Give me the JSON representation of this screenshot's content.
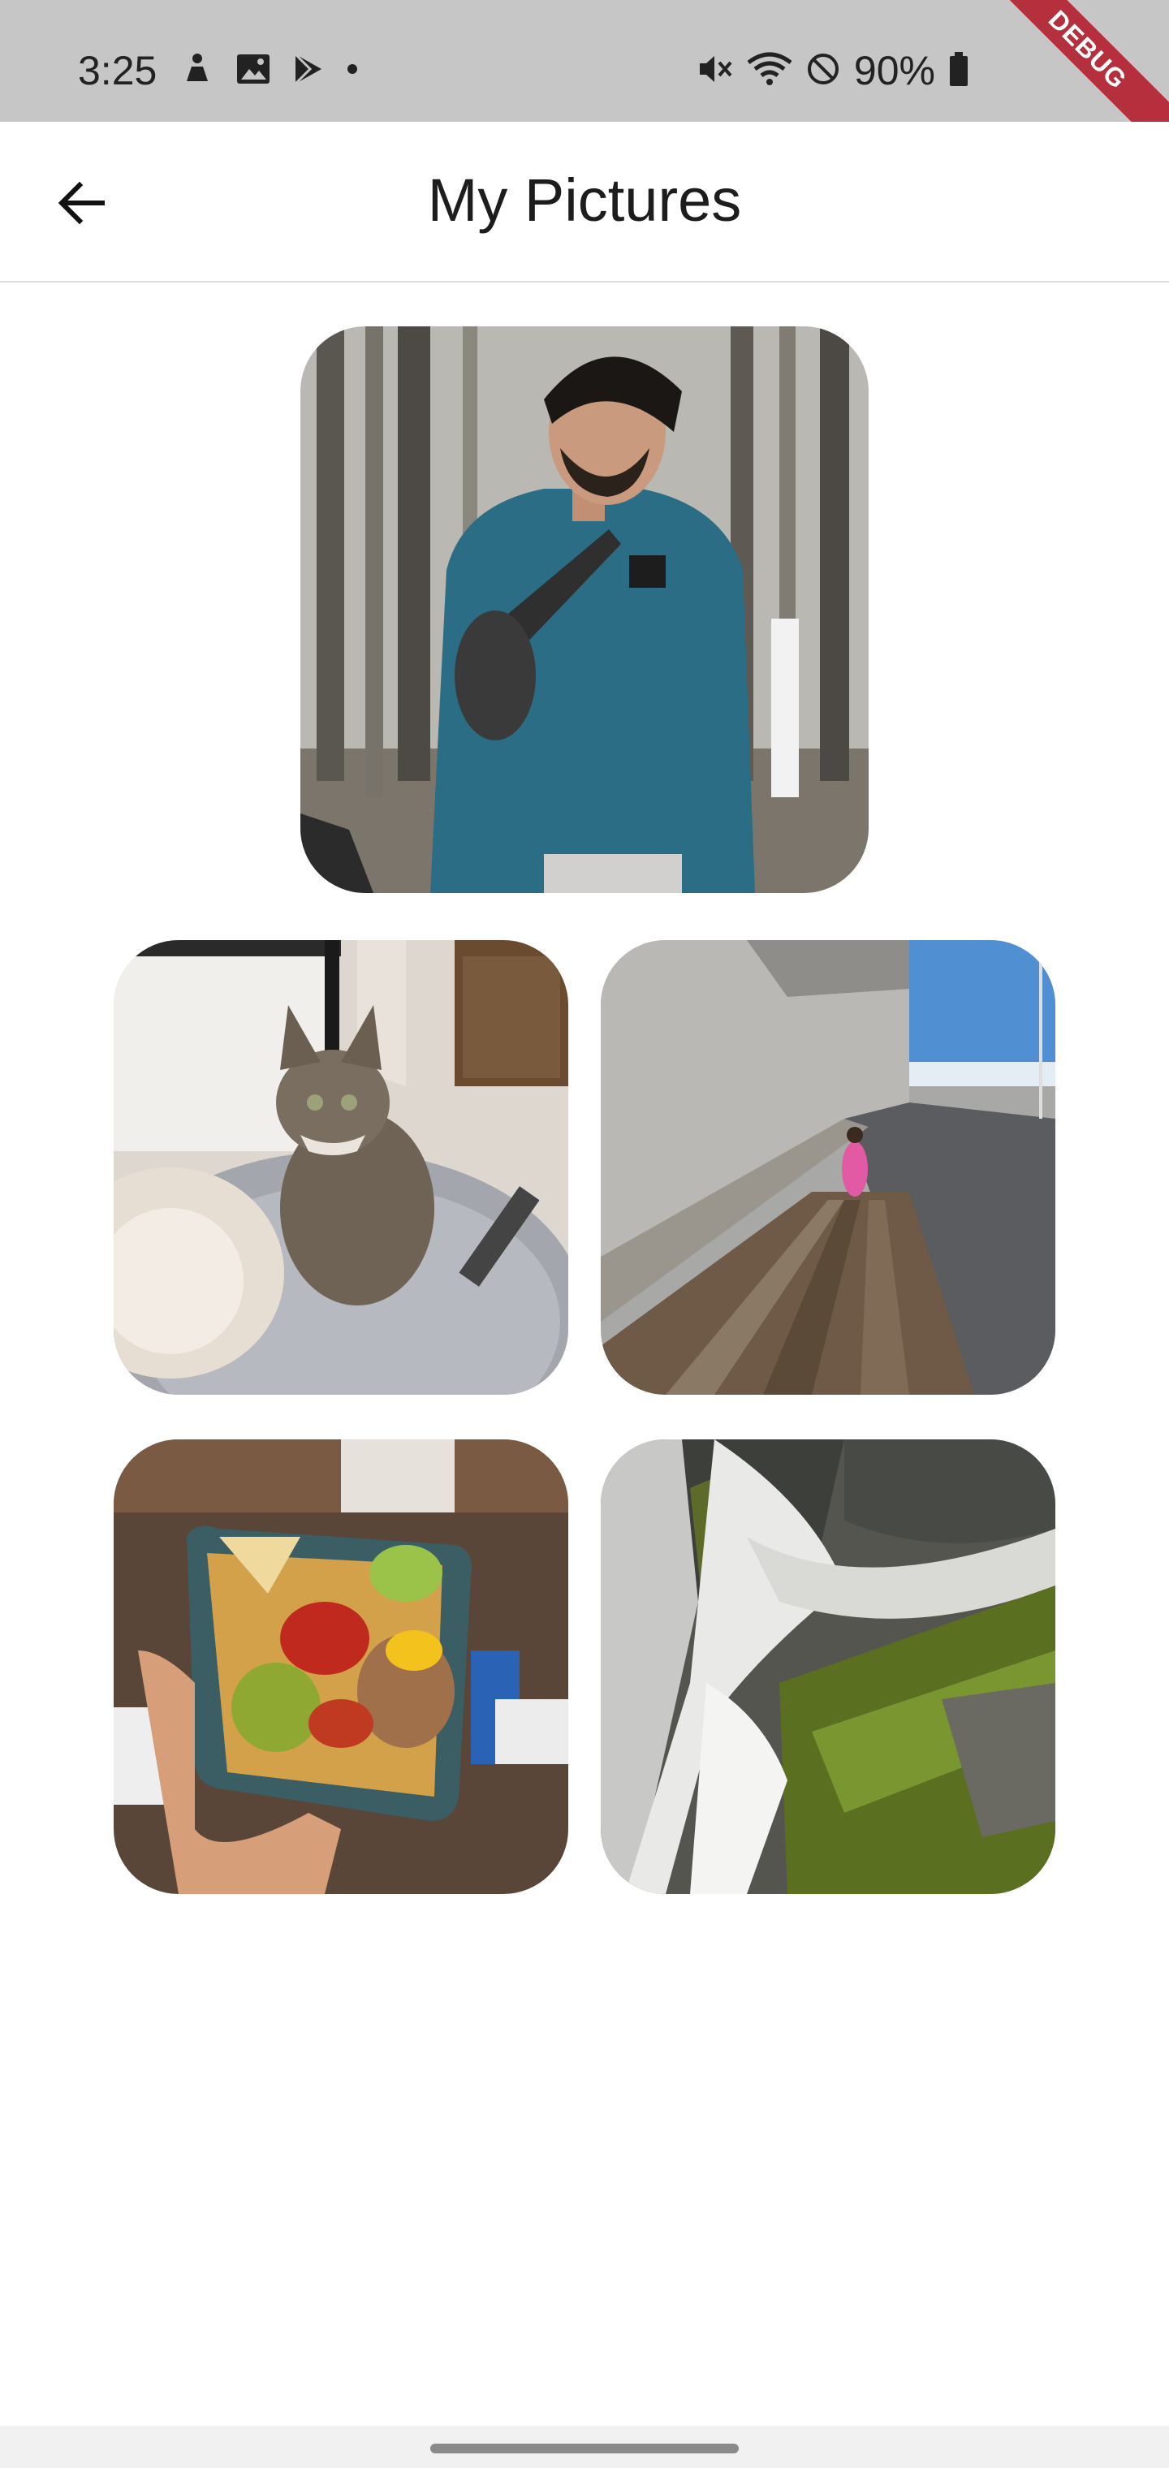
{
  "status_bar": {
    "time": "3:25",
    "battery": "90%",
    "left_icons": [
      "accessibility-icon",
      "gallery-icon",
      "play-store-icon",
      "notification-dot-icon"
    ],
    "right_icons": [
      "mute-icon",
      "wifi-icon",
      "do-not-disturb-icon",
      "battery-icon"
    ],
    "colors": {
      "background": "#c6c6c6",
      "text": "#222222"
    }
  },
  "debug_banner": {
    "label": "DEBUG",
    "color": "#b5303c"
  },
  "app_bar": {
    "title": "My Pictures",
    "back_icon": "arrow-back-icon"
  },
  "gallery": {
    "featured": {
      "subject": "portrait-photo"
    },
    "grid": [
      {
        "subject": "cat-photo"
      },
      {
        "subject": "pier-photo"
      },
      {
        "subject": "nachos-photo"
      },
      {
        "subject": "waterfall-photo"
      }
    ]
  },
  "nav_bar": {
    "handle": "home-handle"
  }
}
